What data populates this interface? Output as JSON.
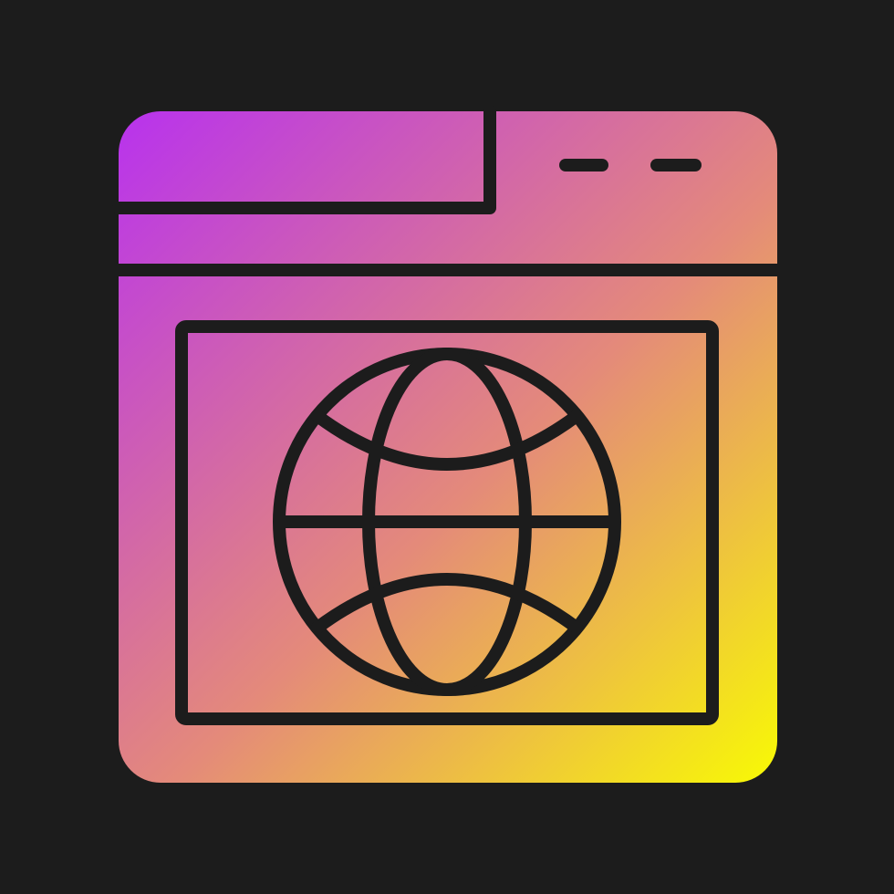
{
  "background_color": "#1c1c1c",
  "icon": {
    "name": "web-browser-globe-icon",
    "gradient_start_color": "#b832ee",
    "gradient_mid_color": "#e48a7a",
    "gradient_end_color": "#f8fa04",
    "stroke_color": "#1c1c1c",
    "window_controls": [
      "minimize-dash",
      "maximize-dash"
    ]
  }
}
